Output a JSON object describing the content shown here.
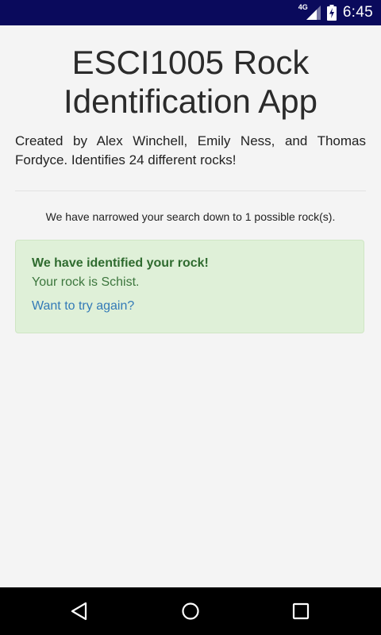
{
  "status_bar": {
    "network": "4G",
    "time": "6:45",
    "background_color": "#0a0a5c",
    "icons": [
      "signal-icon",
      "battery-charging-icon"
    ]
  },
  "header": {
    "title": "ESCI1005 Rock Identification App",
    "subtitle": "Created by Alex Winchell, Emily Ness, and Thomas Fordyce. Identifies 24 different rocks!"
  },
  "search": {
    "narrowed_text": "We have narrowed your search down to 1 possible rock(s)."
  },
  "result": {
    "heading": "We have identified your rock!",
    "message": "Your rock is Schist.",
    "retry_link": "Want to try again?",
    "colors": {
      "background": "#dff0d8",
      "text": "#3c763d",
      "link": "#337ab7"
    }
  },
  "nav_bar": {
    "icons": [
      "back-icon",
      "home-icon",
      "recents-icon"
    ]
  }
}
